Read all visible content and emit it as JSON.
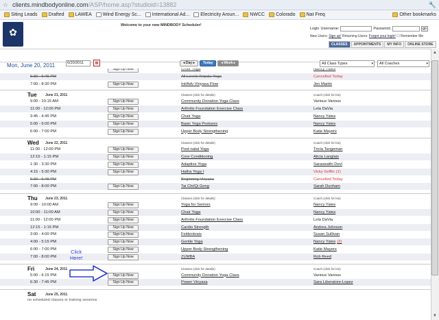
{
  "browser": {
    "url_host": "clients.mindbodyonline.com",
    "url_path": "/ASP/home.asp?studioid=13882",
    "bookmarks": [
      "Siting Leads",
      "Drafted",
      "LAWEA",
      "Wind Energy Sc...",
      "International Ad...",
      "Electricity Aroun...",
      "NWCC",
      "Colorado",
      "Nat Freq"
    ],
    "other_bookmarks": "Other bookmarks"
  },
  "header": {
    "welcome": "Welcome to your new MINDBODY Scheduler!",
    "login_label": "Login",
    "username_label": "Username:",
    "password_label": "Password:",
    "go": "go",
    "new_users": "New Users:",
    "sign_up": "Sign up!",
    "returning": "Returning Users:",
    "forgot": "Forgot your login!",
    "remember": "Remember Me",
    "tabs": [
      "CLASSES",
      "APPOINTMENTS",
      "MY INFO",
      "ONLINE STORE"
    ]
  },
  "toolbar": {
    "date_title": "Mon, June 20, 2011",
    "date_value": "6/20/2011",
    "day_btn": "Day",
    "today_btn": "Today",
    "week_btn": "Week",
    "class_types": "All Class Types",
    "coaches": "All Coaches"
  },
  "signup_label": "Sign Up Now",
  "col_classes": "Classes  (click for details)",
  "col_coach": "Coach (click for bio)",
  "days": [
    {
      "name": "Tue",
      "date": "June 21, 2011",
      "rows": [
        {
          "time": "9:00 - 10:15 AM",
          "cls": "Community Donation Yoga Class",
          "coach": "Various Various"
        },
        {
          "time": "11:00 - 12:00 PM",
          "cls": "Arthritis Foundation Exercise Class",
          "coach": "Lela DaVia"
        },
        {
          "time": "3:45 - 4:45 PM",
          "cls": "Chair Yoga",
          "coach": "Nancy Yates"
        },
        {
          "time": "5:00 - 6:00 PM",
          "cls": "Basic Yoga Postures",
          "coach": "Nancy Yates"
        },
        {
          "time": "6:00 - 7:00 PM",
          "cls": "Upper Body Strengthening",
          "coach": "Katie Mayers"
        }
      ]
    },
    {
      "name": "Wed",
      "date": "June 22, 2011",
      "rows": [
        {
          "time": "11:00 - 12:00 PM",
          "cls": "Post-natal Yoga",
          "coach": "Tricia Tangeman"
        },
        {
          "time": "12:15 - 1:15 PM",
          "cls": "Core Conditioning",
          "coach": "Alicia Langlais"
        },
        {
          "time": "1:30 - 3:30 PM",
          "cls": "Adaptive Yoga",
          "coach": "Saraswathi Devi"
        },
        {
          "time": "4:15 - 5:30 PM",
          "cls": "Hatha Yoga I",
          "coach": "Vicky Griffin",
          "extra": "(1)"
        },
        {
          "time": "5:30 - 6:45 PM",
          "cls": "Beginning Vinyasa",
          "coach": "Cancelled Today"
        },
        {
          "time": "7:00 - 8:00 PM",
          "cls": "Tai Chi/Qi Gong",
          "coach": "Sarah Dunham"
        }
      ]
    },
    {
      "name": "Thu",
      "date": "June 23, 2011",
      "rows": [
        {
          "time": "9:00 - 10:00 AM",
          "cls": "Yoga for Seniors",
          "coach": "Nancy Yates"
        },
        {
          "time": "10:00 - 11:00 AM",
          "cls": "Chair Yoga",
          "coach": "Nancy Yates"
        },
        {
          "time": "11:00 - 12:00 PM",
          "cls": "Arthritis Foundation Exercise Class",
          "coach": "Lela DaVia"
        },
        {
          "time": "12:15 - 1:15 PM",
          "cls": "Cardio Strength",
          "coach": "Andrea Johnson"
        },
        {
          "time": "3:00 - 4:00 PM",
          "cls": "Feldenkrais",
          "coach": "Susan Sullivan"
        },
        {
          "time": "4:00 - 5:15 PM",
          "cls": "Gentle Yoga",
          "coach": "Nancy Yates",
          "extra": "(2)"
        },
        {
          "time": "6:00 - 7:00 PM",
          "cls": "Upper Body Strengthening",
          "coach": "Katie Mayers"
        },
        {
          "time": "7:00 - 8:00 PM",
          "cls": "ZUMBA",
          "coach": "Rob Reed"
        }
      ]
    },
    {
      "name": "Fri",
      "date": "June 24, 2011",
      "rows": [
        {
          "time": "5:00 - 6:15 PM",
          "cls": "Community Donation Yoga Class",
          "coach": "Various Various"
        },
        {
          "time": "6:30 - 7:45 PM",
          "cls": "Power Vinyasa",
          "coach": "Sara Liberatore-Lopez"
        }
      ]
    },
    {
      "name": "Sat",
      "date": "June 25, 2011",
      "rows": []
    }
  ],
  "monday_tail": [
    {
      "time": "",
      "cls": "Chair Yoga",
      "coach": "Nancy Yates"
    },
    {
      "time": "5:30 - 6:45 PM",
      "cls": "All Levels Kripalu Yoga",
      "coach": "Cancelled Today"
    },
    {
      "time": "7:00 - 8:30 PM",
      "cls": "Int/Adv Vinyasa Flow",
      "coach": "Jen Martin"
    }
  ],
  "saturday_note": "no scheduled classes or training sessions",
  "annotation": {
    "line1": "Click",
    "line2": "Here!"
  },
  "colors": {
    "accent": "#1d4f91",
    "cancel": "#d33",
    "annotation": "#2b3bd0"
  }
}
